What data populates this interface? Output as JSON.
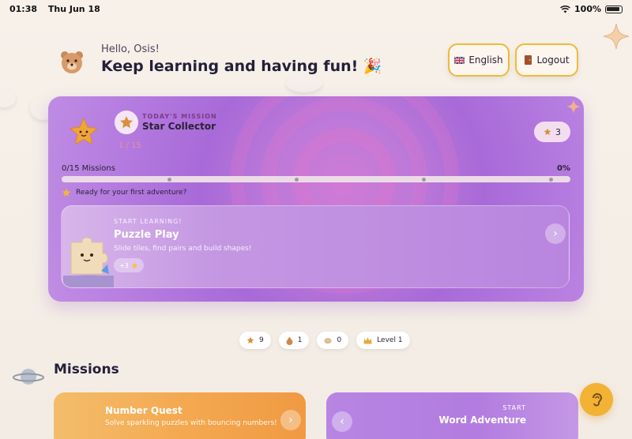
{
  "status": {
    "time": "01:38",
    "date": "Thu Jun 18",
    "battery": "100%"
  },
  "header": {
    "greeting": "Hello, Osis!",
    "headline": "Keep learning and having fun! 🎉",
    "language_button": "English",
    "logout_button": "Logout"
  },
  "mission": {
    "kicker": "TODAY'S MISSION",
    "title": "Star Collector",
    "faint_label": "1 / 15",
    "star_count": "3",
    "progress_label": "0/15 Missions",
    "progress_percent": "0%",
    "progress_fraction": 0,
    "ready_text": "Ready for your first adventure?"
  },
  "puzzle": {
    "kicker": "START LEARNING!",
    "title": "Puzzle Play",
    "description": "Slide tiles, find pairs and build shapes!",
    "reward": "+3"
  },
  "stats": [
    {
      "icon": "star-icon",
      "value": "9"
    },
    {
      "icon": "droplet-icon",
      "value": "1"
    },
    {
      "icon": "coin-icon",
      "value": "0"
    },
    {
      "icon": "crown-icon",
      "value": "Level 1"
    }
  ],
  "missions_section": {
    "title": "Missions",
    "cards": [
      {
        "title": "Number Quest",
        "description": "Solve sparkling puzzles with bouncing numbers!"
      },
      {
        "kicker": "START",
        "title": "Word Adventure"
      }
    ]
  },
  "colors": {
    "accent": "#f0b93a",
    "mission_purple": "#b47adf",
    "quest_orange": "#f4a951"
  }
}
